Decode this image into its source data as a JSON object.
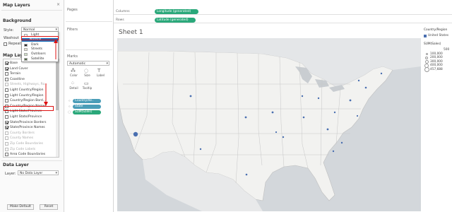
{
  "left_pane": {
    "title": "Map Layers",
    "background_header": "Background",
    "style_label": "Style:",
    "style_value": "Normal",
    "washout_label": "Washout",
    "repeat_label": "Repeat",
    "dropdown_options": [
      "Light",
      "Normal",
      "Dark",
      "Streets",
      "Outdoors",
      "Satellite"
    ],
    "map_layers_header": "Map Layers",
    "layers": [
      {
        "label": "Base",
        "checked": true,
        "disabled": false
      },
      {
        "label": "Land Cover",
        "checked": true,
        "disabled": false
      },
      {
        "label": "Terrain",
        "checked": false,
        "disabled": false
      },
      {
        "label": "Coastline",
        "checked": false,
        "disabled": false
      },
      {
        "label": "Streets, Highways, Ro...",
        "checked": false,
        "disabled": true
      },
      {
        "label": "Light Country/Region",
        "checked": false,
        "disabled": false
      },
      {
        "label": "Light Country/Region",
        "checked": false,
        "disabled": false
      },
      {
        "label": "Country/Region Bord...",
        "checked": false,
        "disabled": false
      },
      {
        "label": "Country/Region Names",
        "checked": false,
        "disabled": false
      },
      {
        "label": "Light State/Province",
        "checked": false,
        "disabled": false
      },
      {
        "label": "Light State/Province",
        "checked": false,
        "disabled": false
      },
      {
        "label": "State/Province Borders",
        "checked": true,
        "disabled": false
      },
      {
        "label": "State/Province Names",
        "checked": true,
        "disabled": false
      },
      {
        "label": "County Borders",
        "checked": false,
        "disabled": true
      },
      {
        "label": "County Names",
        "checked": false,
        "disabled": true
      },
      {
        "label": "Zip Code Boundaries",
        "checked": false,
        "disabled": true
      },
      {
        "label": "Zip Code Labels",
        "checked": false,
        "disabled": true
      },
      {
        "label": "Area Code Boundaries",
        "checked": false,
        "disabled": false
      }
    ],
    "data_layer_header": "Data Layer",
    "data_layer_label": "Layer:",
    "data_layer_value": "No Data Layer",
    "make_default_label": "Make Default",
    "reset_label": "Reset"
  },
  "cards": {
    "pages_title": "Pages",
    "filters_title": "Filters",
    "marks_title": "Marks",
    "marks_type": "Automatic",
    "mark_buttons": [
      {
        "label": "Color",
        "icon": "color-icon"
      },
      {
        "label": "Size",
        "icon": "size-icon"
      },
      {
        "label": "Label",
        "icon": "label-icon"
      },
      {
        "label": "Detail",
        "icon": "detail-icon"
      },
      {
        "label": "Tooltip",
        "icon": "tooltip-icon"
      }
    ],
    "mark_pills": [
      {
        "label": "Country/Re..",
        "color": "#4a9db8"
      },
      {
        "label": "State",
        "color": "#4a9db8"
      },
      {
        "label": "SUM(Sales)",
        "color": "#2aa87a"
      }
    ]
  },
  "shelves": {
    "columns_label": "Columns",
    "columns_pill": "Longitude (generated)",
    "rows_label": "Rows",
    "rows_pill": "Latitude (generated)"
  },
  "sheet": {
    "title": "Sheet 1"
  },
  "legend": {
    "title": "Country/Region",
    "entry": "United States",
    "size_title": "SUM(Sales)",
    "size_values": [
      "500",
      "100,000",
      "200,000",
      "300,000",
      "400,000",
      "457,688"
    ]
  },
  "colors": {
    "accent_blue": "#4a9db8",
    "accent_green": "#2aa87a",
    "mark": "#4a6fb0",
    "highlight_red": "#dd1111"
  }
}
